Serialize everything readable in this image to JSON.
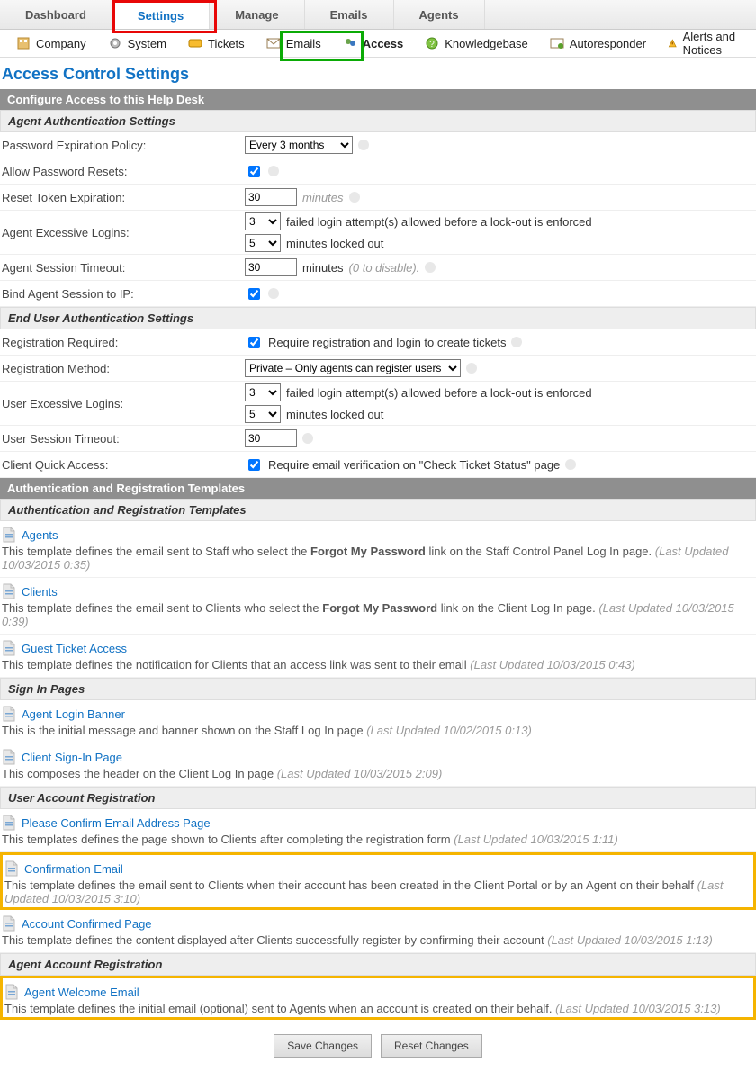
{
  "top_tabs": [
    "Dashboard",
    "Settings",
    "Manage",
    "Emails",
    "Agents"
  ],
  "top_active": 1,
  "sub_tabs": [
    {
      "label": "Company",
      "icon": "#ico-company"
    },
    {
      "label": "System",
      "icon": "#ico-gear"
    },
    {
      "label": "Tickets",
      "icon": "#ico-ticket"
    },
    {
      "label": "Emails",
      "icon": "#ico-mail"
    },
    {
      "label": "Access",
      "icon": "#ico-agents"
    },
    {
      "label": "Knowledgebase",
      "icon": "#ico-kb"
    },
    {
      "label": "Autoresponder",
      "icon": "#ico-auto"
    },
    {
      "label": "Alerts and Notices",
      "icon": "#ico-alert"
    }
  ],
  "sub_active": 4,
  "page_title": "Access Control Settings",
  "config_bar": "Configure Access to this Help Desk",
  "section_agent": "Agent Authentication Settings",
  "section_enduser": "End User Authentication Settings",
  "section_templates_bar": "Authentication and Registration Templates",
  "section_templates_head": "Authentication and Registration Templates",
  "section_signin": "Sign In Pages",
  "section_userreg": "User Account Registration",
  "section_agentreg": "Agent Account Registration",
  "labels": {
    "pwd_policy": "Password Expiration Policy:",
    "allow_reset": "Allow Password Resets:",
    "reset_token": "Reset Token Expiration:",
    "agent_excess": "Agent Excessive Logins:",
    "agent_session": "Agent Session Timeout:",
    "bind_ip": "Bind Agent Session to IP:",
    "reg_required": "Registration Required:",
    "reg_method": "Registration Method:",
    "user_excess": "User Excessive Logins:",
    "user_session": "User Session Timeout:",
    "quick_access": "Client Quick Access:"
  },
  "values": {
    "pwd_policy": "Every 3 months",
    "allow_reset": true,
    "reset_token": "30",
    "reset_token_unit": "minutes",
    "agent_fail_cnt": "3",
    "agent_fail_txt": "failed login attempt(s) allowed before a lock-out is enforced",
    "agent_lock_min": "5",
    "agent_lock_txt": "minutes locked out",
    "agent_session": "30",
    "agent_session_unit": "minutes",
    "agent_session_hint": "(0 to disable).",
    "bind_ip": true,
    "reg_required": true,
    "reg_required_txt": "Require registration and login to create tickets",
    "reg_method": "Private – Only agents can register users",
    "user_fail_cnt": "3",
    "user_fail_txt": "failed login attempt(s) allowed before a lock-out is enforced",
    "user_lock_min": "5",
    "user_lock_txt": "minutes locked out",
    "user_session": "30",
    "quick_access": true,
    "quick_access_txt": "Require email verification on \"Check Ticket Status\" page"
  },
  "templates": {
    "agents": {
      "title": "Agents",
      "desc_a": "This template defines the email sent to Staff who select the ",
      "bold": "Forgot My Password",
      "desc_b": " link on the Staff Control Panel Log In page. ",
      "upd": "(Last Updated 10/03/2015 0:35)"
    },
    "clients": {
      "title": "Clients",
      "desc_a": "This template defines the email sent to Clients who select the ",
      "bold": "Forgot My Password",
      "desc_b": " link on the Client Log In page. ",
      "upd": "(Last Updated 10/03/2015 0:39)"
    },
    "guest": {
      "title": "Guest Ticket Access",
      "desc": "This template defines the notification for Clients that an access link was sent to their email ",
      "upd": "(Last Updated 10/03/2015 0:43)"
    },
    "banner": {
      "title": "Agent Login Banner",
      "desc": "This is the initial message and banner shown on the Staff Log In page ",
      "upd": "(Last Updated 10/02/2015 0:13)"
    },
    "signin": {
      "title": "Client Sign-In Page",
      "desc": "This composes the header on the Client Log In page ",
      "upd": "(Last Updated 10/03/2015 2:09)"
    },
    "confirm_page": {
      "title": "Please Confirm Email Address Page",
      "desc": "This templates defines the page shown to Clients after completing the registration form ",
      "upd": "(Last Updated 10/03/2015 1:11)"
    },
    "confirm_email": {
      "title": "Confirmation Email",
      "desc": "This template defines the email sent to Clients when their account has been created in the Client Portal or by an Agent on their behalf ",
      "upd": "(Last Updated 10/03/2015 3:10)"
    },
    "account_confirmed": {
      "title": "Account Confirmed Page",
      "desc": "This template defines the content displayed after Clients successfully register by confirming their account ",
      "upd": "(Last Updated 10/03/2015 1:13)"
    },
    "welcome": {
      "title": "Agent Welcome Email",
      "desc": "This template defines the initial email (optional) sent to Agents when an account is created on their behalf. ",
      "upd": "(Last Updated 10/03/2015 3:13)"
    }
  },
  "buttons": {
    "save": "Save Changes",
    "reset": "Reset Changes"
  }
}
